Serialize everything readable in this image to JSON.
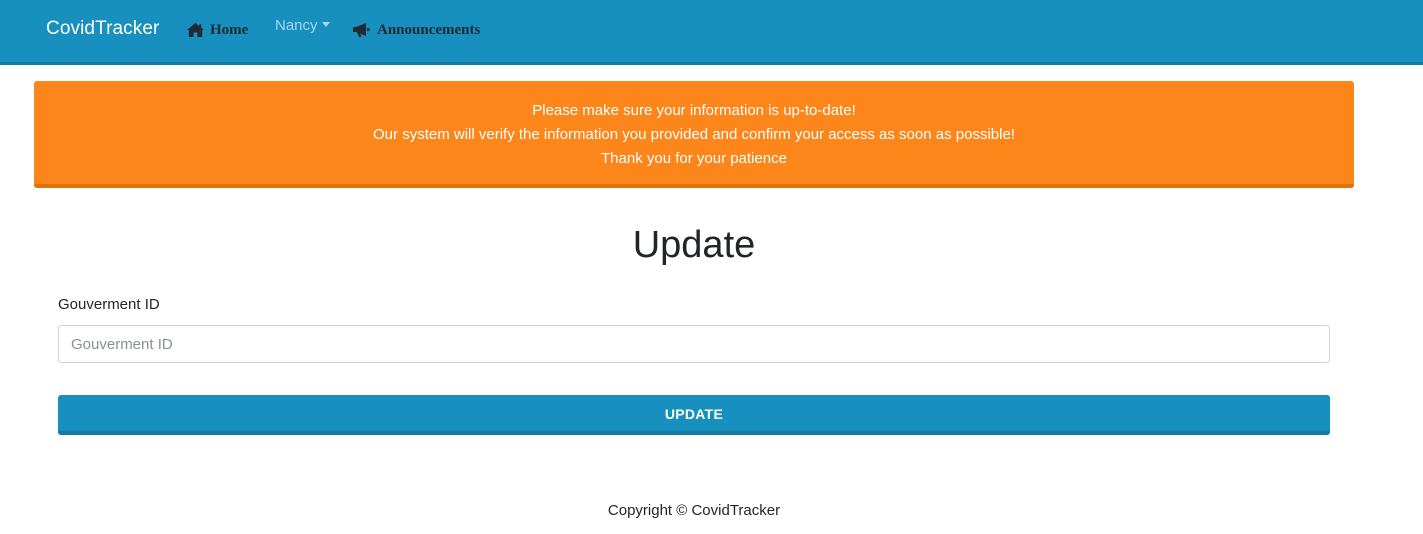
{
  "navbar": {
    "brand": "CovidTracker",
    "home_label": "Home",
    "home_icon": "home-icon",
    "user_label": "Nancy",
    "announcements_label": "Announcements",
    "announcements_icon": "megaphone-icon"
  },
  "alert": {
    "lines": [
      "Please make sure your information is up-to-date!",
      "Our system will verify the information you provided and confirm your access as soon as possible!",
      "Thank you for your patience"
    ],
    "color": "#fd861b"
  },
  "main": {
    "title": "Update",
    "field_label": "Gouverment ID",
    "field_placeholder": "Gouverment ID",
    "field_value": "",
    "button_label": "UPDATE"
  },
  "footer": {
    "text": "Copyright © CovidTracker"
  },
  "colors": {
    "primary": "#1890bf",
    "warning": "#fd861b"
  }
}
